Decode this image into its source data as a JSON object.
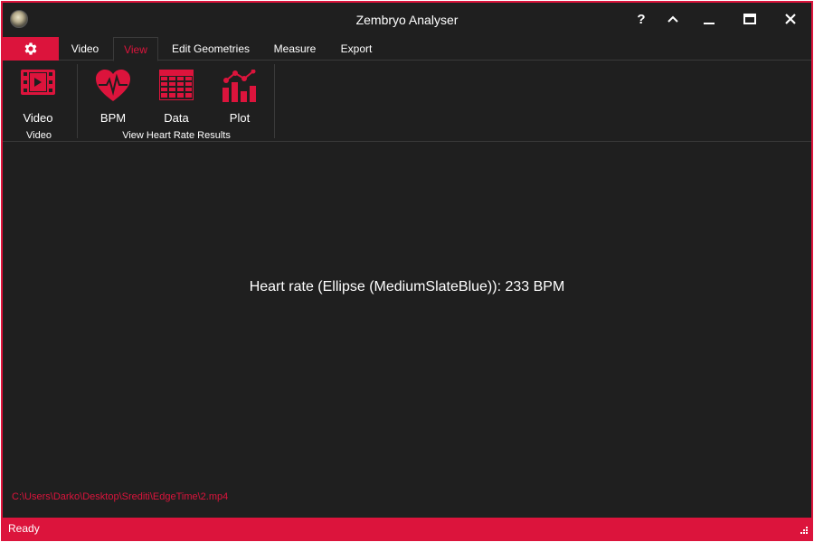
{
  "window": {
    "title": "Zembryo Analyser"
  },
  "ribbon_tabs": [
    "Video",
    "View",
    "Edit Geometries",
    "Measure",
    "Export"
  ],
  "active_tab": "View",
  "ribbon": {
    "video_group": {
      "button_label": "Video",
      "group_label": "Video"
    },
    "results_group": {
      "buttons": [
        "BPM",
        "Data",
        "Plot"
      ],
      "group_label": "View Heart Rate Results"
    }
  },
  "main": {
    "heart_rate_text": "Heart rate (Ellipse (MediumSlateBlue)): 233 BPM",
    "file_path": "C:\\Users\\Darko\\Desktop\\Srediti\\EdgeTime\\2.mp4"
  },
  "status": {
    "text": "Ready"
  },
  "colors": {
    "accent": "#dc143c",
    "background": "#1f1f1f",
    "separator": "#3a3a3a",
    "text": "#ffffff"
  },
  "icons": [
    "app-logo",
    "help-icon",
    "collapse-ribbon-icon",
    "minimize-icon",
    "maximize-icon",
    "close-icon",
    "gear-icon",
    "film-play-icon",
    "heart-pulse-icon",
    "table-grid-icon",
    "chart-plot-icon",
    "resize-grip-icon"
  ]
}
